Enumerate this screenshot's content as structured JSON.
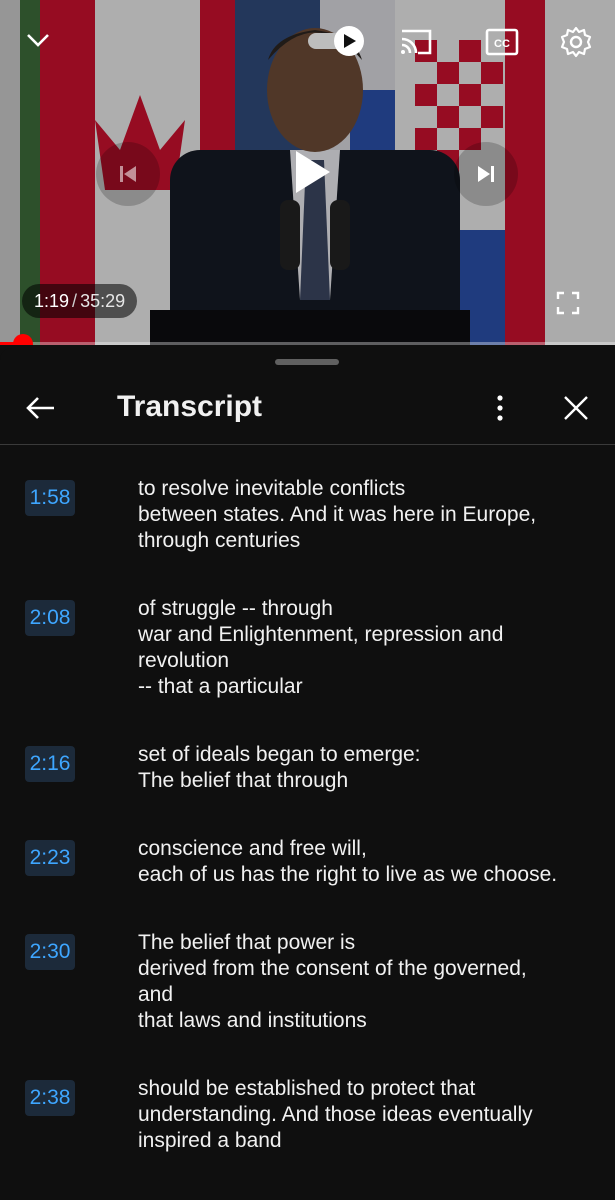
{
  "player": {
    "current_time": "1:19",
    "separator": "/",
    "duration": "35:29",
    "progress": 0.037,
    "accent_color": "#ff0000",
    "icons": [
      "chevron-down-icon",
      "autoplay-toggle-icon",
      "cast-icon",
      "captions-icon",
      "settings-icon",
      "previous-icon",
      "play-icon",
      "next-icon",
      "fullscreen-icon"
    ],
    "captions_label": "CC"
  },
  "transcript": {
    "title": "Transcript",
    "icons": [
      "back-arrow-icon",
      "more-vert-icon",
      "close-icon"
    ],
    "timestamp_color": "#3ea6ff",
    "segments": [
      {
        "time": "1:58",
        "text": "to resolve inevitable conflicts\nbetween states. And it was here in Europe,\nthrough centuries"
      },
      {
        "time": "2:08",
        "text": "of struggle -- through\nwar and Enlightenment, repression and\nrevolution\n-- that a particular"
      },
      {
        "time": "2:16",
        "text": "set of ideals began to emerge:\nThe belief that through"
      },
      {
        "time": "2:23",
        "text": "conscience and free will,\neach of us has the right to live as we choose."
      },
      {
        "time": "2:30",
        "text": "The belief that power is\nderived from the consent of the governed,\nand\nthat laws and institutions"
      },
      {
        "time": "2:38",
        "text": "should be established to protect that\nunderstanding. And those ideas eventually\ninspired a band"
      }
    ]
  }
}
